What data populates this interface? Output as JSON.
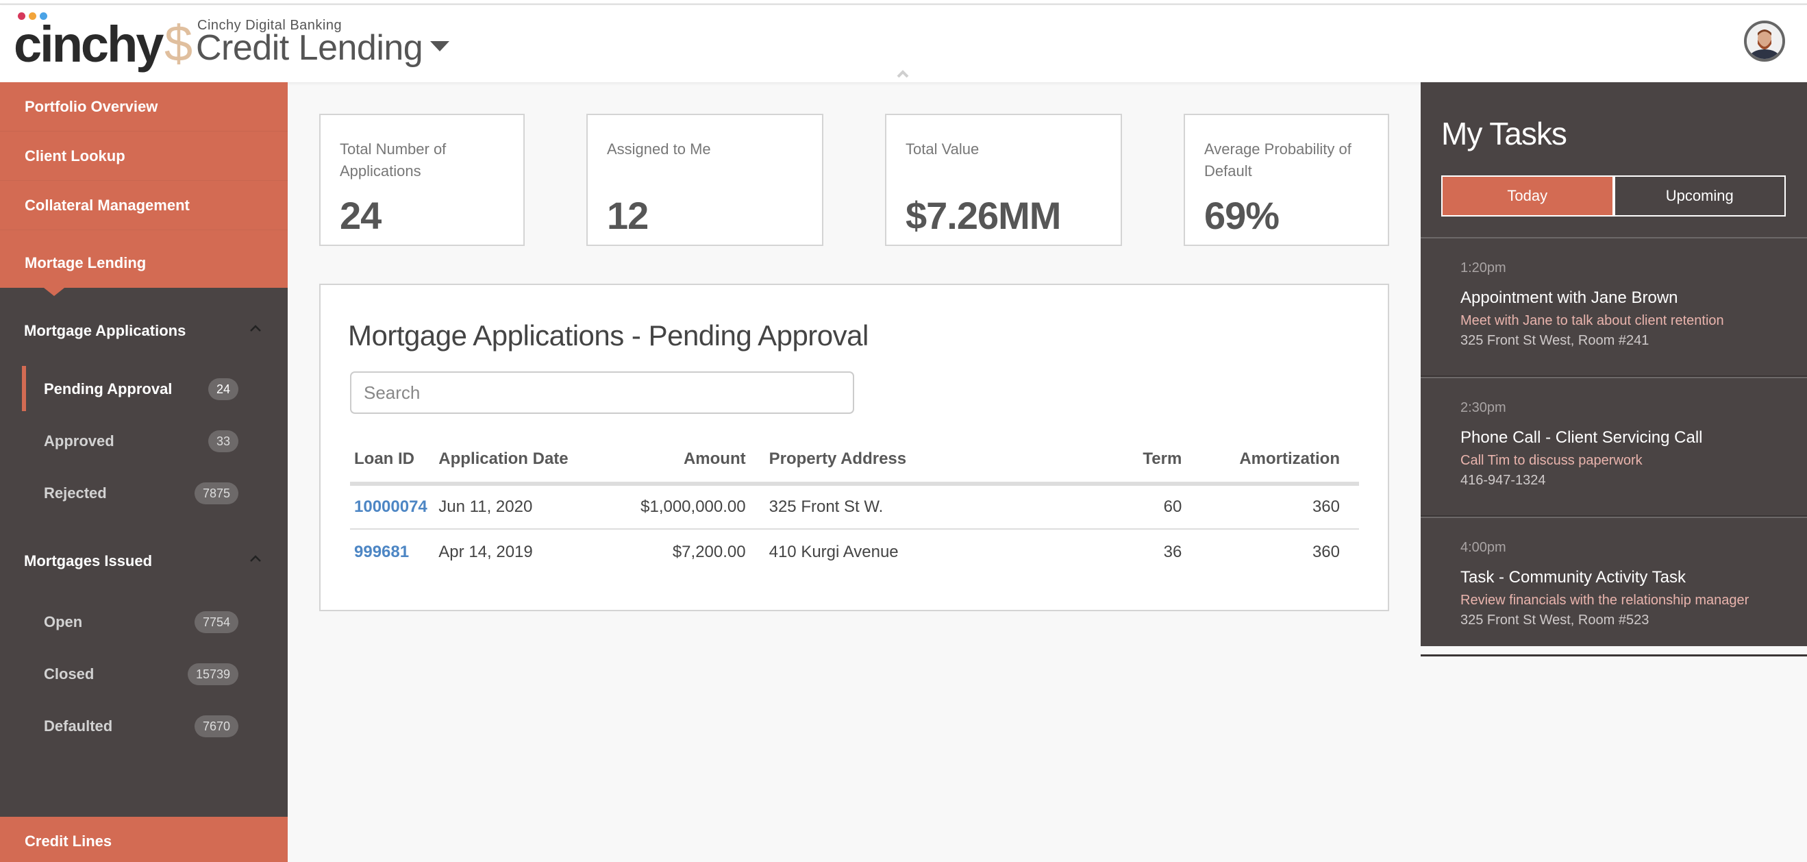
{
  "header": {
    "logo_text": "cinchy",
    "logo_dot_colors": [
      "#d6385b",
      "#f2a43a",
      "#4aa3e6"
    ],
    "brand_color": "#d36b53",
    "dollar_symbol": "$",
    "app_subtitle": "Cinchy Digital Banking",
    "app_title": "Credit Lending"
  },
  "sidebar": {
    "top_items": [
      {
        "label": "Portfolio Overview"
      },
      {
        "label": "Client Lookup"
      },
      {
        "label": "Collateral Management"
      },
      {
        "label": "Mortage Lending",
        "active": true
      }
    ],
    "sections": [
      {
        "title": "Mortgage Applications",
        "items": [
          {
            "label": "Pending Approval",
            "count": "24",
            "active": true
          },
          {
            "label": "Approved",
            "count": "33"
          },
          {
            "label": "Rejected",
            "count": "7875"
          }
        ]
      },
      {
        "title": "Mortgages Issued",
        "items": [
          {
            "label": "Open",
            "count": "7754"
          },
          {
            "label": "Closed",
            "count": "15739"
          },
          {
            "label": "Defaulted",
            "count": "7670"
          }
        ]
      }
    ],
    "bottom_item": {
      "label": "Credit Lines"
    }
  },
  "stats": [
    {
      "label": "Total Number of Applications",
      "value": "24"
    },
    {
      "label": "Assigned to Me",
      "value": "12"
    },
    {
      "label": "Total Value",
      "value": "$7.26MM"
    },
    {
      "label": "Average Probability of Default",
      "value": "69%"
    }
  ],
  "applications": {
    "title": "Mortgage Applications - Pending Approval",
    "search_placeholder": "Search",
    "search_value": "",
    "columns": [
      "Loan ID",
      "Application Date",
      "Amount",
      "Property Address",
      "Term",
      "Amortization"
    ],
    "rows": [
      {
        "loan_id": "10000074",
        "date": "Jun 11, 2020",
        "amount": "$1,000,000.00",
        "address": "325 Front St W.",
        "term": "60",
        "amortization": "360"
      },
      {
        "loan_id": "999681",
        "date": "Apr 14, 2019",
        "amount": "$7,200.00",
        "address": "410 Kurgi Avenue",
        "term": "36",
        "amortization": "360"
      }
    ]
  },
  "tasks": {
    "title": "My Tasks",
    "tabs": [
      {
        "label": "Today",
        "active": true
      },
      {
        "label": "Upcoming",
        "active": false
      }
    ],
    "items": [
      {
        "time": "1:20pm",
        "title": "Appointment with Jane Brown",
        "description": "Meet with Jane to talk about client retention",
        "location": "325 Front St West, Room #241"
      },
      {
        "time": "2:30pm",
        "title": "Phone Call - Client Servicing Call",
        "description": "Call Tim to discuss paperwork",
        "location": "416-947-1324"
      },
      {
        "time": "4:00pm",
        "title": "Task - Community Activity Task",
        "description": "Review financials with the relationship manager",
        "location": "325 Front St West, Room #523"
      }
    ]
  }
}
